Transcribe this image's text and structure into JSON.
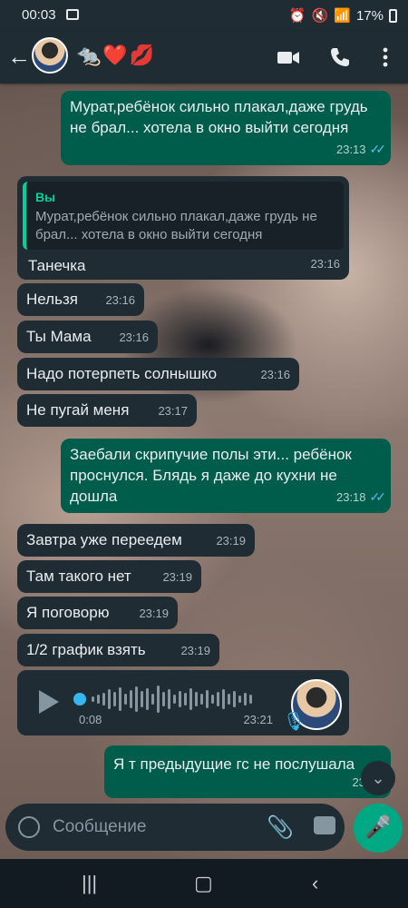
{
  "status_bar": {
    "time": "00:03",
    "battery": "17%"
  },
  "header": {
    "title": "🐀❤️💋"
  },
  "messages": [
    {
      "type": "out",
      "text": "Мурат,ребёнок сильно плакал,даже грудь не брал... хотела в окно выйти сегодня",
      "time": "23:13"
    },
    {
      "type": "in",
      "quote_author": "Вы",
      "quote_text": "Мурат,ребёнок сильно плакал,даже грудь не брал... хотела в окно выйти сегодня",
      "text": "Танечка",
      "time": "23:16"
    },
    {
      "type": "in",
      "text": "Нельзя",
      "time": "23:16"
    },
    {
      "type": "in",
      "text": "Ты Мама",
      "time": "23:16"
    },
    {
      "type": "in",
      "text": "Надо потерпеть солнышко",
      "time": "23:16"
    },
    {
      "type": "in",
      "text": "Не пугай меня",
      "time": "23:17"
    },
    {
      "type": "out",
      "text": "Заебали скрипучие полы эти... ребёнок проснулся. Блядь я даже до кухни не дошла",
      "time": "23:18"
    },
    {
      "type": "in",
      "text": "Завтра уже переедем",
      "time": "23:19"
    },
    {
      "type": "in",
      "text": "Там такого нет",
      "time": "23:19"
    },
    {
      "type": "in",
      "text": "Я поговорю",
      "time": "23:19"
    },
    {
      "type": "in",
      "text": "1/2 график взять",
      "time": "23:19"
    },
    {
      "type": "voice",
      "duration": "0:08",
      "time": "23:21"
    },
    {
      "type": "out",
      "text": "Я т предыдущие гс не послушала",
      "time": "23:24"
    }
  ],
  "input": {
    "placeholder": "Сообщение"
  }
}
